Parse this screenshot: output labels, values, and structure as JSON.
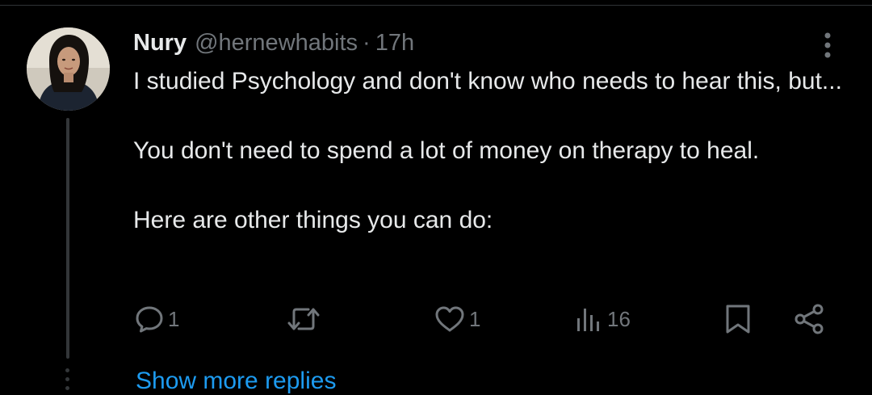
{
  "tweet": {
    "author_name": "Nury",
    "handle": "@hernewhabits",
    "separator": "·",
    "time": "17h",
    "paragraphs": [
      "I studied Psychology and don't know who needs to hear this, but...",
      "You don't need to spend a lot of money on therapy to heal.",
      "Here are other things you can do:"
    ],
    "actions": {
      "reply_count": "1",
      "retweet_count": "",
      "like_count": "1",
      "views_count": "16"
    }
  },
  "thread": {
    "show_more_label": "Show more replies"
  },
  "colors": {
    "background": "#000000",
    "text_primary": "#e7e9ea",
    "text_secondary": "#71767b",
    "link": "#1d9bf0",
    "divider": "#2f3336"
  },
  "icons": {
    "reply": "speech-bubble-icon",
    "retweet": "retweet-arrows-icon",
    "like": "heart-icon",
    "views": "bar-chart-icon",
    "bookmark": "bookmark-icon",
    "share": "share-nodes-icon",
    "more": "vertical-ellipsis-icon"
  }
}
